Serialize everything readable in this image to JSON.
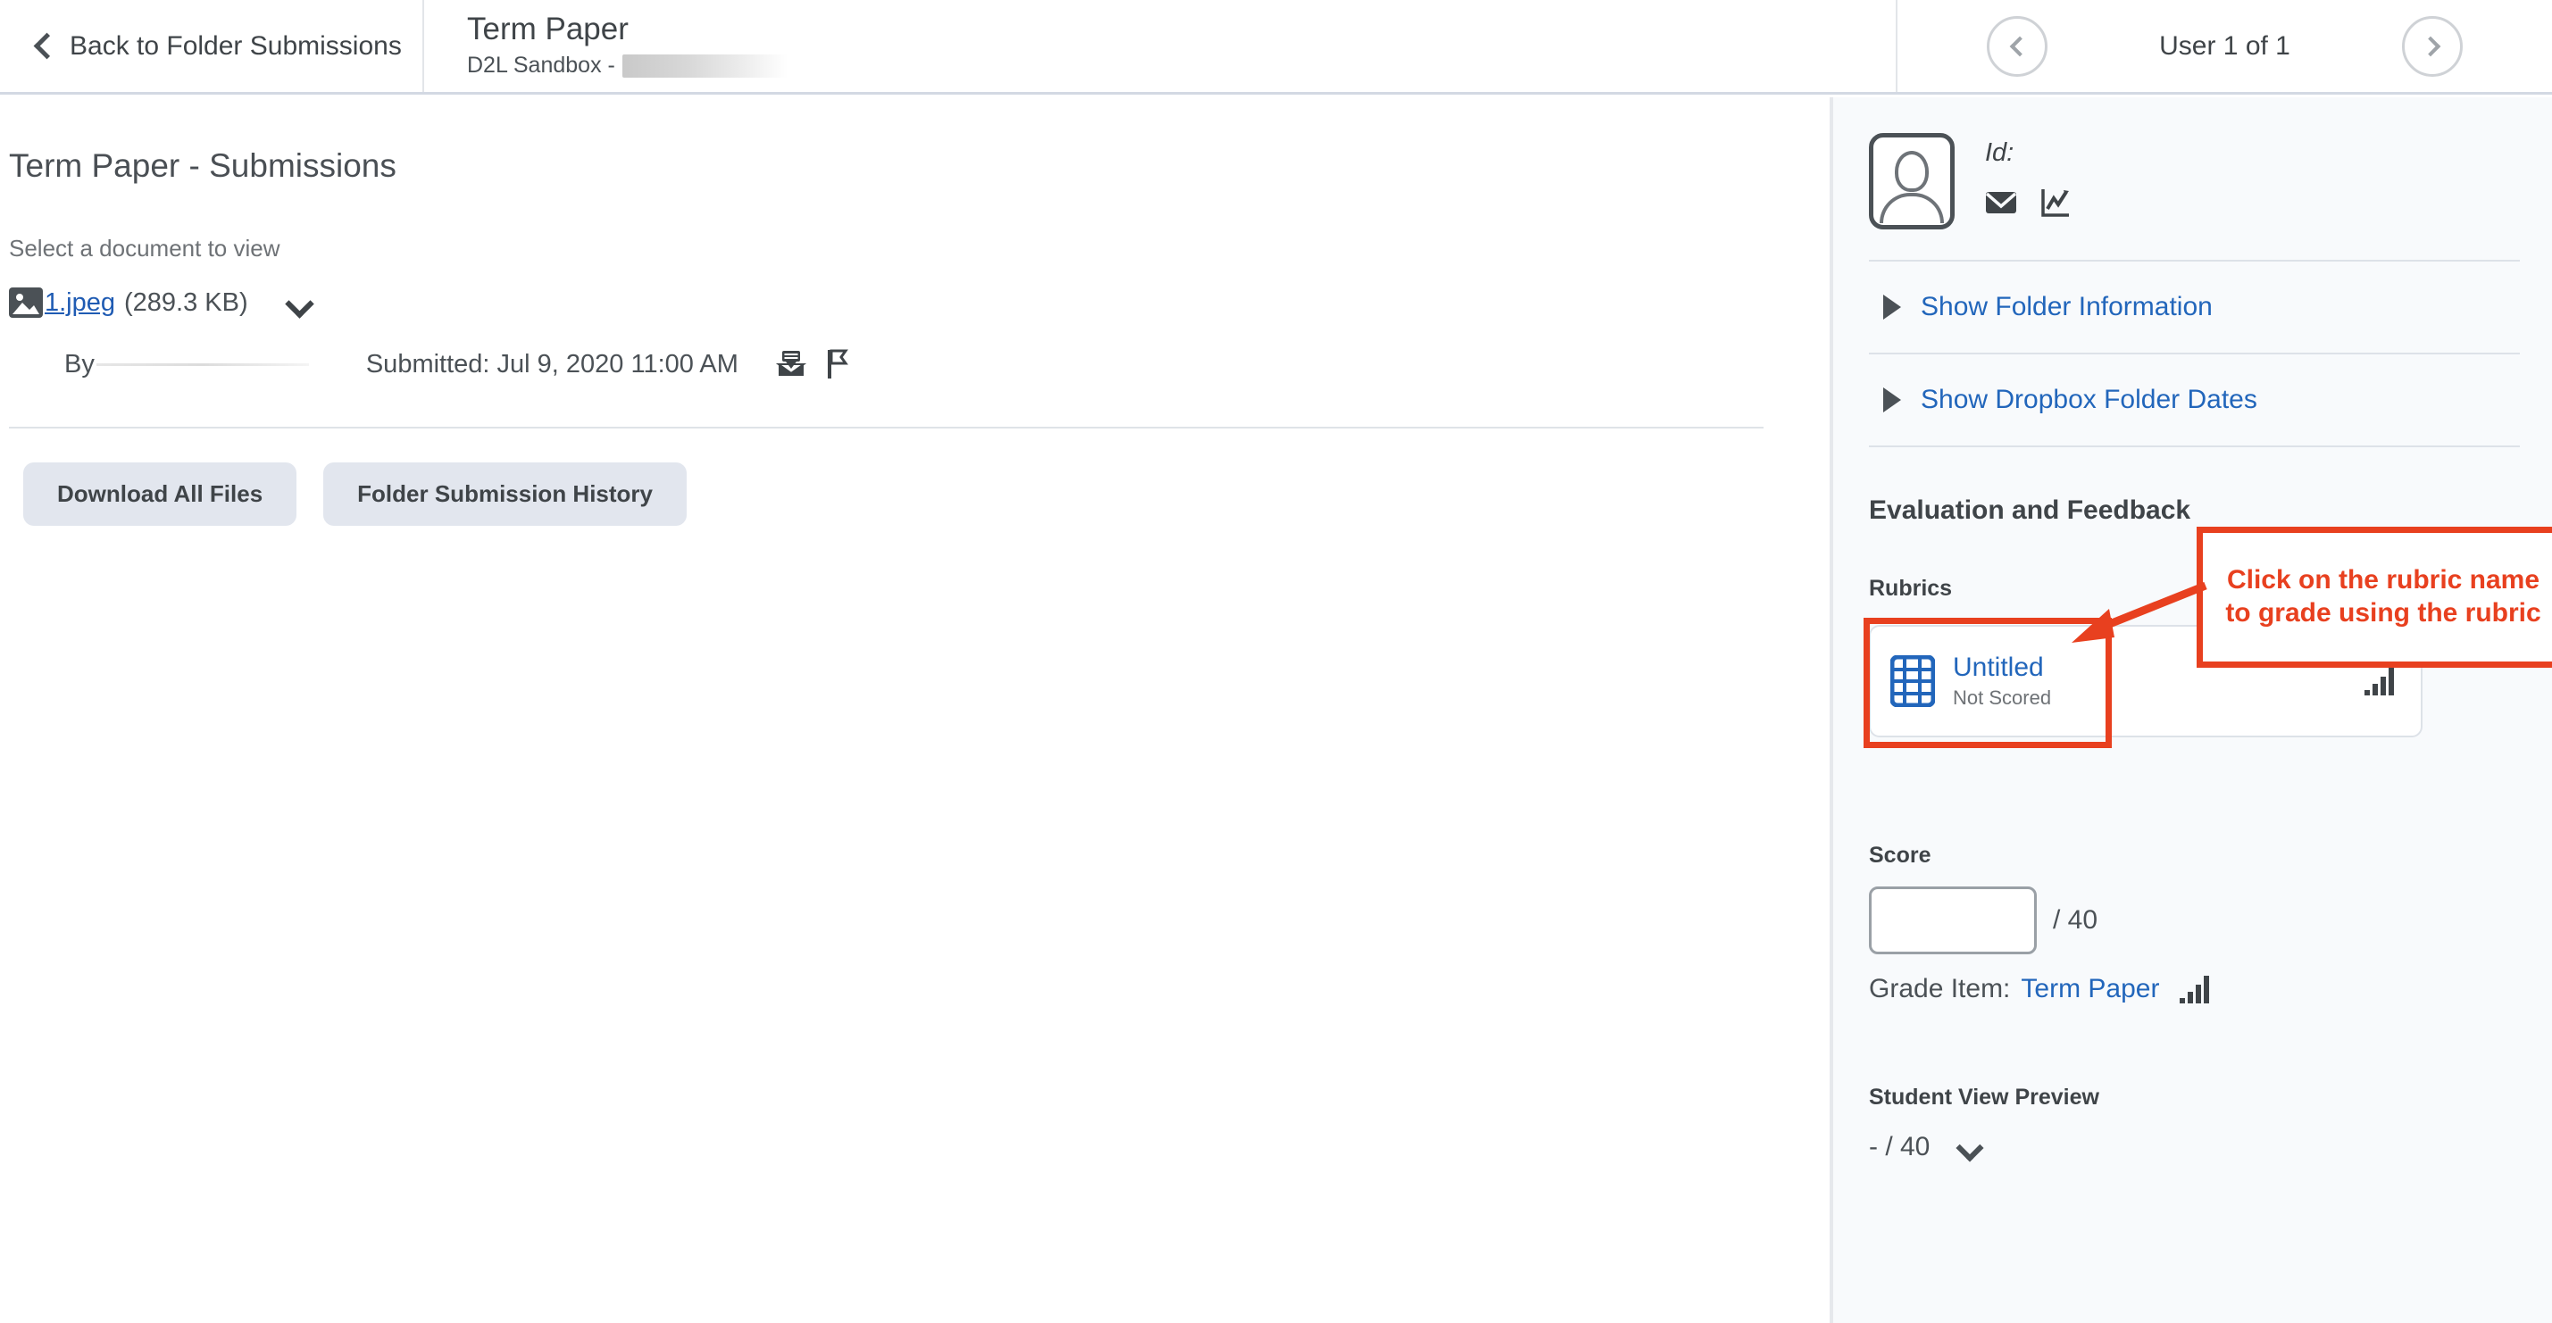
{
  "header": {
    "back_label": "Back to Folder Submissions",
    "back_icon": "chevron-left-icon",
    "title": "Term Paper",
    "subtitle_prefix": "D2L Sandbox - ",
    "subtitle_redacted": true,
    "prev_icon": "chevron-left-circle-icon",
    "next_icon": "chevron-right-circle-icon",
    "user_count": "User 1 of 1"
  },
  "main": {
    "page_title": "Term Paper - Submissions",
    "select_doc_label": "Select a document to view",
    "file": {
      "icon": "image-file-icon",
      "name": "1.jpeg",
      "size": "(289.3 KB)",
      "expand_icon": "chevron-down-icon"
    },
    "by_label": "By",
    "submitted_label": "Submitted: Jul 9, 2020 11:00 AM",
    "inbox_icon": "inbox-download-icon",
    "flag_icon": "flag-icon",
    "buttons": {
      "download_all": "Download All Files",
      "submission_history": "Folder Submission History"
    }
  },
  "sidebar": {
    "avatar_icon": "user-avatar-icon",
    "id_label": "Id:",
    "email_icon": "envelope-icon",
    "stats_icon": "line-chart-icon",
    "disclosures": [
      {
        "label": "Show Folder Information",
        "icon": "triangle-right-icon"
      },
      {
        "label": "Show Dropbox Folder Dates",
        "icon": "triangle-right-icon"
      }
    ],
    "evaluation_title": "Evaluation and Feedback",
    "rubrics_label": "Rubrics",
    "rubric": {
      "icon": "rubric-grid-icon",
      "name": "Untitled",
      "status": "Not Scored",
      "stats_icon": "bar-chart-icon"
    },
    "callout": {
      "text": "Click on the rubric name to grade using the rubric",
      "color": "#e8401f",
      "arrow_icon": "arrow-pointer-icon"
    },
    "score": {
      "label": "Score",
      "value": "",
      "placeholder": "",
      "out_of": "/ 40",
      "grade_item_label": "Grade Item:",
      "grade_item_link": "Term Paper",
      "grade_item_stats_icon": "bar-chart-icon"
    },
    "student_view": {
      "label": "Student View Preview",
      "value": "- / 40",
      "expand_icon": "chevron-down-icon"
    }
  },
  "colors": {
    "link_blue": "#2266bb",
    "accent_red": "#e8401f",
    "sidebar_bg": "#f8fafc",
    "button_bg": "#e2e6ee",
    "text": "#3f4448"
  }
}
